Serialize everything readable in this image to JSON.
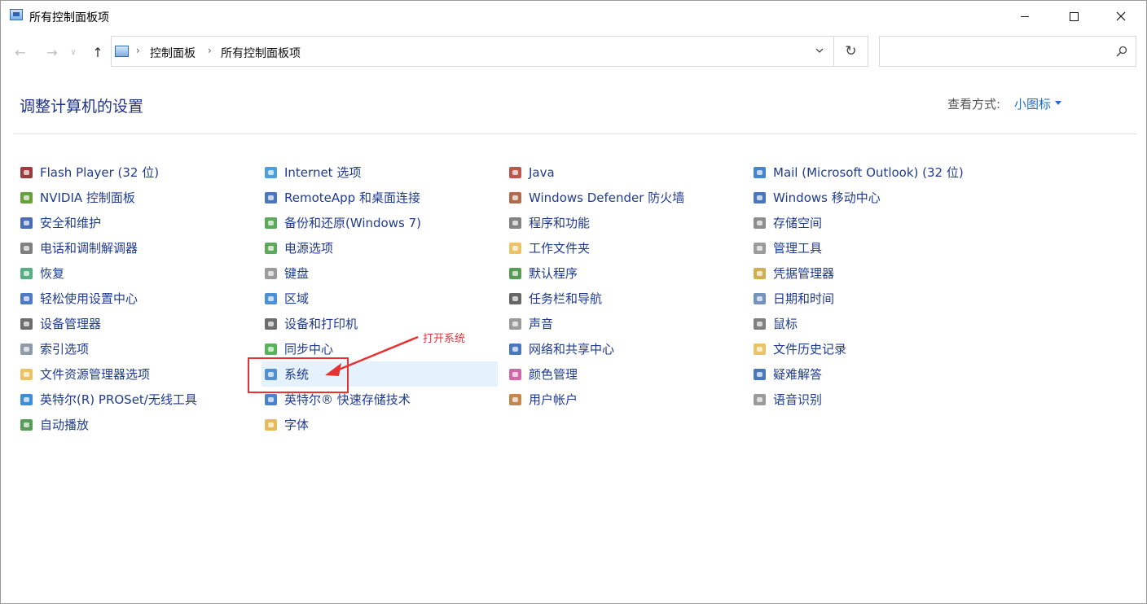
{
  "window": {
    "title": "所有控制面板项"
  },
  "address": {
    "crumbs": [
      "控制面板",
      "所有控制面板项"
    ]
  },
  "search": {
    "placeholder": ""
  },
  "header": {
    "title": "调整计算机的设置",
    "view_by_label": "查看方式:",
    "view_by_value": "小图标"
  },
  "annotation": {
    "text": "打开系统"
  },
  "accent": "#1f6fcf",
  "columns": [
    [
      {
        "label": "Flash Player (32 位)",
        "icon": "flash-icon",
        "color": "#8b1a1a"
      },
      {
        "label": "NVIDIA 控制面板",
        "icon": "nvidia-icon",
        "color": "#4d8f1a"
      },
      {
        "label": "安全和维护",
        "icon": "flag-icon",
        "color": "#2852a8"
      },
      {
        "label": "电话和调制解调器",
        "icon": "phone-icon",
        "color": "#6a6a6a"
      },
      {
        "label": "恢复",
        "icon": "recovery-icon",
        "color": "#3aa06a"
      },
      {
        "label": "轻松使用设置中心",
        "icon": "accessibility-icon",
        "color": "#2f62b8"
      },
      {
        "label": "设备管理器",
        "icon": "device-manager-icon",
        "color": "#555555"
      },
      {
        "label": "索引选项",
        "icon": "index-icon",
        "color": "#7a8a99"
      },
      {
        "label": "文件资源管理器选项",
        "icon": "folder-options-icon",
        "color": "#e7b84a"
      },
      {
        "label": "英特尔(R) PROSet/无线工具",
        "icon": "wireless-icon",
        "color": "#1f7ad1"
      },
      {
        "label": "自动播放",
        "icon": "autoplay-icon",
        "color": "#3a8b3a"
      }
    ],
    [
      {
        "label": "Internet 选项",
        "icon": "internet-icon",
        "color": "#2c8fd6"
      },
      {
        "label": "RemoteApp 和桌面连接",
        "icon": "remoteapp-icon",
        "color": "#2b5fb0"
      },
      {
        "label": "备份和还原(Windows 7)",
        "icon": "backup-icon",
        "color": "#3f9a3f"
      },
      {
        "label": "电源选项",
        "icon": "power-icon",
        "color": "#3f9a3f"
      },
      {
        "label": "键盘",
        "icon": "keyboard-icon",
        "color": "#8a8a8a"
      },
      {
        "label": "区域",
        "icon": "region-icon",
        "color": "#2c7fcc"
      },
      {
        "label": "设备和打印机",
        "icon": "printer-icon",
        "color": "#555555"
      },
      {
        "label": "同步中心",
        "icon": "sync-icon",
        "color": "#3aa63a"
      },
      {
        "label": "系统",
        "icon": "system-icon",
        "color": "#3a7fc9"
      },
      {
        "label": "英特尔® 快速存储技术",
        "icon": "storage-tech-icon",
        "color": "#2c6fc4"
      },
      {
        "label": "字体",
        "icon": "font-icon",
        "color": "#e0b040"
      }
    ],
    [
      {
        "label": "Java",
        "icon": "java-icon",
        "color": "#b03a2e"
      },
      {
        "label": "Windows Defender 防火墙",
        "icon": "firewall-icon",
        "color": "#a0522d"
      },
      {
        "label": "程序和功能",
        "icon": "programs-icon",
        "color": "#6d6d6d"
      },
      {
        "label": "工作文件夹",
        "icon": "work-folders-icon",
        "color": "#e7b84a"
      },
      {
        "label": "默认程序",
        "icon": "default-programs-icon",
        "color": "#3a8b3a"
      },
      {
        "label": "任务栏和导航",
        "icon": "taskbar-icon",
        "color": "#4b4b4b"
      },
      {
        "label": "声音",
        "icon": "sound-icon",
        "color": "#8a8a8a"
      },
      {
        "label": "网络和共享中心",
        "icon": "network-icon",
        "color": "#2b5fb0"
      },
      {
        "label": "颜色管理",
        "icon": "color-management-icon",
        "color": "#c94f9a"
      },
      {
        "label": "用户帐户",
        "icon": "user-accounts-icon",
        "color": "#b87333"
      }
    ],
    [
      {
        "label": "Mail (Microsoft Outlook) (32 位)",
        "icon": "mail-icon",
        "color": "#2470c4"
      },
      {
        "label": "Windows 移动中心",
        "icon": "mobility-icon",
        "color": "#2b5fb0"
      },
      {
        "label": "存储空间",
        "icon": "storage-spaces-icon",
        "color": "#7a7a7a"
      },
      {
        "label": "管理工具",
        "icon": "admin-tools-icon",
        "color": "#8a8a8a"
      },
      {
        "label": "凭据管理器",
        "icon": "credential-icon",
        "color": "#c9a030"
      },
      {
        "label": "日期和时间",
        "icon": "clock-icon",
        "color": "#5b7fb0"
      },
      {
        "label": "鼠标",
        "icon": "mouse-icon",
        "color": "#6a6a6a"
      },
      {
        "label": "文件历史记录",
        "icon": "file-history-icon",
        "color": "#e7b84a"
      },
      {
        "label": "疑难解答",
        "icon": "troubleshoot-icon",
        "color": "#2b5fb0"
      },
      {
        "label": "语音识别",
        "icon": "microphone-icon",
        "color": "#8a8a8a"
      }
    ]
  ]
}
